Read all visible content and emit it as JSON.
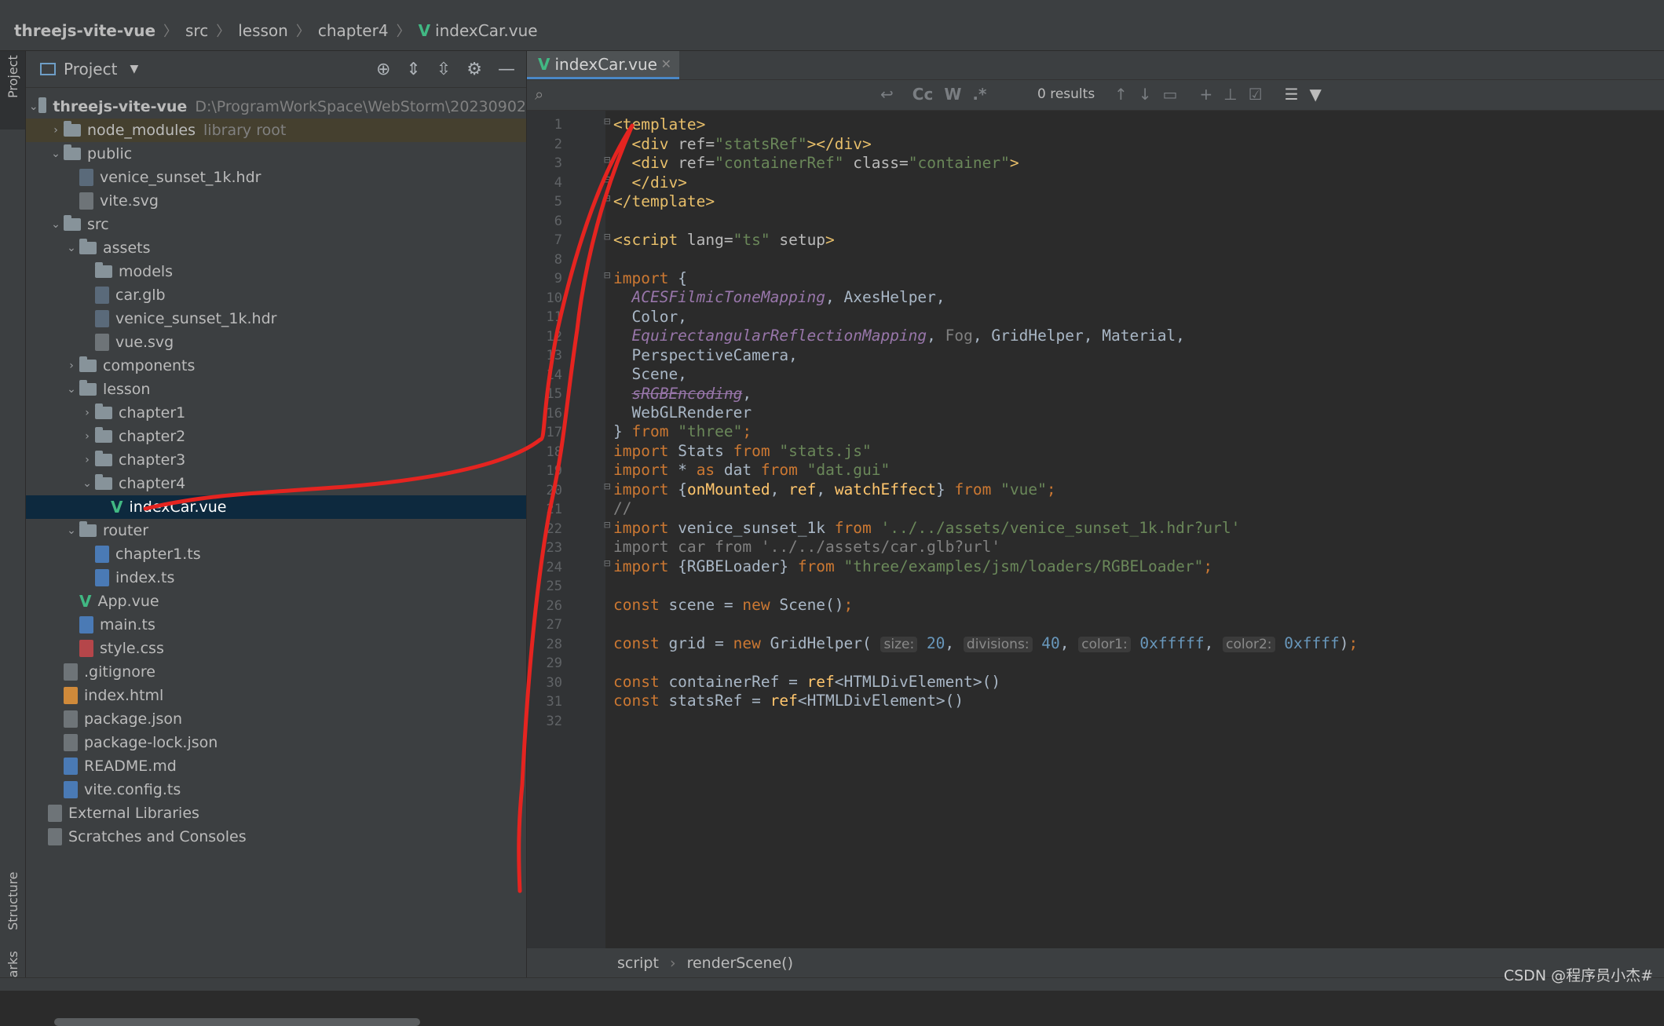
{
  "breadcrumb": {
    "project": "threejs-vite-vue",
    "c1": "src",
    "c2": "lesson",
    "c3": "chapter4",
    "file": "indexCar.vue"
  },
  "sidebar_tabs": {
    "project": "Project",
    "structure": "Structure",
    "marks": "marks"
  },
  "project_panel": {
    "title": "Project",
    "tree": [
      {
        "indent": 0,
        "arrow": "v",
        "type": "folder",
        "label": "threejs-vite-vue",
        "extra": "D:\\ProgramWorkSpace\\WebStorm\\20230902",
        "bold": true
      },
      {
        "indent": 1,
        "arrow": ">",
        "type": "folder",
        "label": "node_modules",
        "extra": "library root",
        "libroot": true
      },
      {
        "indent": 1,
        "arrow": "v",
        "type": "folder",
        "label": "public"
      },
      {
        "indent": 2,
        "arrow": "",
        "type": "hdr",
        "label": "venice_sunset_1k.hdr"
      },
      {
        "indent": 2,
        "arrow": "",
        "type": "file",
        "label": "vite.svg"
      },
      {
        "indent": 1,
        "arrow": "v",
        "type": "folder",
        "label": "src"
      },
      {
        "indent": 2,
        "arrow": "v",
        "type": "folder",
        "label": "assets"
      },
      {
        "indent": 3,
        "arrow": "",
        "type": "folder",
        "label": "models"
      },
      {
        "indent": 3,
        "arrow": "",
        "type": "hdr",
        "label": "car.glb"
      },
      {
        "indent": 3,
        "arrow": "",
        "type": "hdr",
        "label": "venice_sunset_1k.hdr"
      },
      {
        "indent": 3,
        "arrow": "",
        "type": "file",
        "label": "vue.svg"
      },
      {
        "indent": 2,
        "arrow": ">",
        "type": "folder",
        "label": "components"
      },
      {
        "indent": 2,
        "arrow": "v",
        "type": "folder",
        "label": "lesson"
      },
      {
        "indent": 3,
        "arrow": ">",
        "type": "folder",
        "label": "chapter1"
      },
      {
        "indent": 3,
        "arrow": ">",
        "type": "folder",
        "label": "chapter2"
      },
      {
        "indent": 3,
        "arrow": ">",
        "type": "folder",
        "label": "chapter3"
      },
      {
        "indent": 3,
        "arrow": "v",
        "type": "folder",
        "label": "chapter4"
      },
      {
        "indent": 4,
        "arrow": "",
        "type": "vue",
        "label": "indexCar.vue",
        "selected": true
      },
      {
        "indent": 2,
        "arrow": "v",
        "type": "folder",
        "label": "router"
      },
      {
        "indent": 3,
        "arrow": "",
        "type": "ts",
        "label": "chapter1.ts"
      },
      {
        "indent": 3,
        "arrow": "",
        "type": "ts",
        "label": "index.ts"
      },
      {
        "indent": 2,
        "arrow": "",
        "type": "vue",
        "label": "App.vue"
      },
      {
        "indent": 2,
        "arrow": "",
        "type": "ts",
        "label": "main.ts"
      },
      {
        "indent": 2,
        "arrow": "",
        "type": "css",
        "label": "style.css"
      },
      {
        "indent": 1,
        "arrow": "",
        "type": "file",
        "label": ".gitignore"
      },
      {
        "indent": 1,
        "arrow": "",
        "type": "html",
        "label": "index.html"
      },
      {
        "indent": 1,
        "arrow": "",
        "type": "file",
        "label": "package.json"
      },
      {
        "indent": 1,
        "arrow": "",
        "type": "file",
        "label": "package-lock.json"
      },
      {
        "indent": 1,
        "arrow": "",
        "type": "md",
        "label": "README.md"
      },
      {
        "indent": 1,
        "arrow": "",
        "type": "ts",
        "label": "vite.config.ts"
      },
      {
        "indent": 0,
        "arrow": "",
        "type": "lib",
        "label": "External Libraries"
      },
      {
        "indent": 0,
        "arrow": "",
        "type": "scratch",
        "label": "Scratches and Consoles"
      }
    ]
  },
  "editor": {
    "tab_label": "indexCar.vue",
    "search_results": "0 results",
    "search_opts": {
      "cc": "Cc",
      "w": "W",
      "regex": ".*"
    },
    "line_numbers": [
      "1",
      "2",
      "3",
      "4",
      "5",
      "6",
      "7",
      "8",
      "9",
      "10",
      "11",
      "12",
      "13",
      "14",
      "15",
      "16",
      "17",
      "18",
      "19",
      "20",
      "21",
      "22",
      "23",
      "24",
      "25",
      "26",
      "27",
      "28",
      "29",
      "30",
      "31",
      "32"
    ],
    "status": {
      "a": "script",
      "b": "renderScene()"
    }
  },
  "watermark": "CSDN @程序员小杰#"
}
